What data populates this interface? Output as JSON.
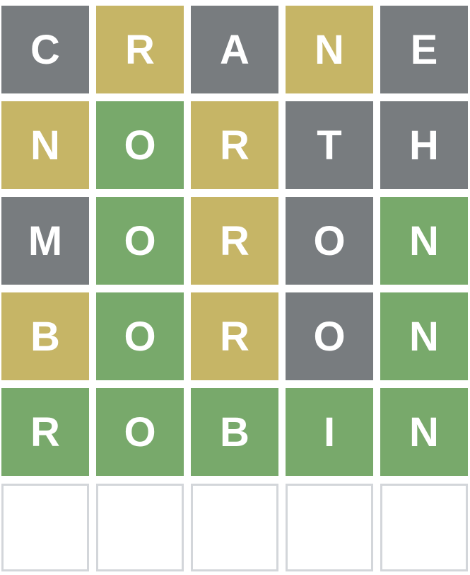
{
  "colors": {
    "correct": "#78a96b",
    "present": "#c6b566",
    "absent": "#787c7f",
    "empty_border": "#d3d6da",
    "letter": "#ffffff"
  },
  "board": {
    "rows": [
      {
        "tiles": [
          {
            "letter": "C",
            "state": "absent"
          },
          {
            "letter": "R",
            "state": "present"
          },
          {
            "letter": "A",
            "state": "absent"
          },
          {
            "letter": "N",
            "state": "present"
          },
          {
            "letter": "E",
            "state": "absent"
          }
        ]
      },
      {
        "tiles": [
          {
            "letter": "N",
            "state": "present"
          },
          {
            "letter": "O",
            "state": "correct"
          },
          {
            "letter": "R",
            "state": "present"
          },
          {
            "letter": "T",
            "state": "absent"
          },
          {
            "letter": "H",
            "state": "absent"
          }
        ]
      },
      {
        "tiles": [
          {
            "letter": "M",
            "state": "absent"
          },
          {
            "letter": "O",
            "state": "correct"
          },
          {
            "letter": "R",
            "state": "present"
          },
          {
            "letter": "O",
            "state": "absent"
          },
          {
            "letter": "N",
            "state": "correct"
          }
        ]
      },
      {
        "tiles": [
          {
            "letter": "B",
            "state": "present"
          },
          {
            "letter": "O",
            "state": "correct"
          },
          {
            "letter": "R",
            "state": "present"
          },
          {
            "letter": "O",
            "state": "absent"
          },
          {
            "letter": "N",
            "state": "correct"
          }
        ]
      },
      {
        "tiles": [
          {
            "letter": "R",
            "state": "correct"
          },
          {
            "letter": "O",
            "state": "correct"
          },
          {
            "letter": "B",
            "state": "correct"
          },
          {
            "letter": "I",
            "state": "correct"
          },
          {
            "letter": "N",
            "state": "correct"
          }
        ]
      },
      {
        "tiles": [
          {
            "letter": "",
            "state": "empty"
          },
          {
            "letter": "",
            "state": "empty"
          },
          {
            "letter": "",
            "state": "empty"
          },
          {
            "letter": "",
            "state": "empty"
          },
          {
            "letter": "",
            "state": "empty"
          }
        ]
      }
    ]
  }
}
